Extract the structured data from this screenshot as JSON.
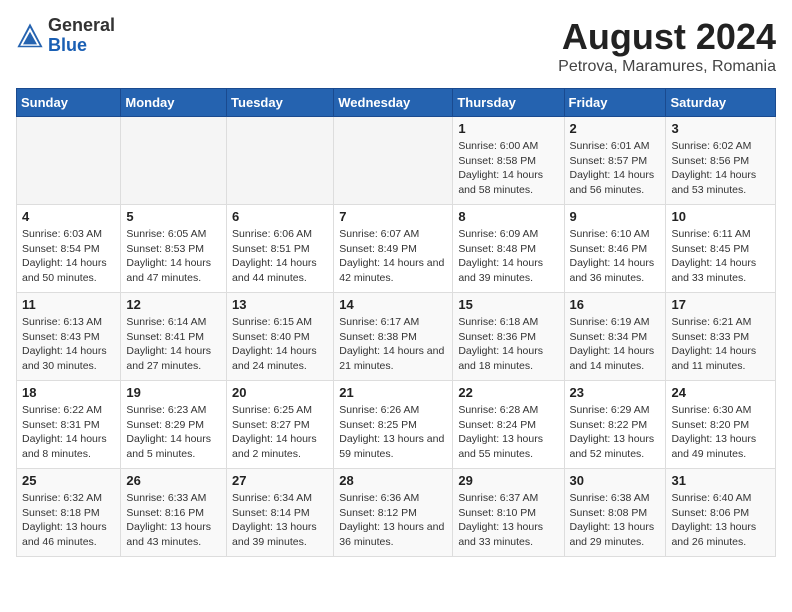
{
  "logo": {
    "general": "General",
    "blue": "Blue"
  },
  "title": "August 2024",
  "subtitle": "Petrova, Maramures, Romania",
  "days_of_week": [
    "Sunday",
    "Monday",
    "Tuesday",
    "Wednesday",
    "Thursday",
    "Friday",
    "Saturday"
  ],
  "weeks": [
    [
      {
        "day": "",
        "info": ""
      },
      {
        "day": "",
        "info": ""
      },
      {
        "day": "",
        "info": ""
      },
      {
        "day": "",
        "info": ""
      },
      {
        "day": "1",
        "info": "Sunrise: 6:00 AM\nSunset: 8:58 PM\nDaylight: 14 hours and 58 minutes."
      },
      {
        "day": "2",
        "info": "Sunrise: 6:01 AM\nSunset: 8:57 PM\nDaylight: 14 hours and 56 minutes."
      },
      {
        "day": "3",
        "info": "Sunrise: 6:02 AM\nSunset: 8:56 PM\nDaylight: 14 hours and 53 minutes."
      }
    ],
    [
      {
        "day": "4",
        "info": "Sunrise: 6:03 AM\nSunset: 8:54 PM\nDaylight: 14 hours and 50 minutes."
      },
      {
        "day": "5",
        "info": "Sunrise: 6:05 AM\nSunset: 8:53 PM\nDaylight: 14 hours and 47 minutes."
      },
      {
        "day": "6",
        "info": "Sunrise: 6:06 AM\nSunset: 8:51 PM\nDaylight: 14 hours and 44 minutes."
      },
      {
        "day": "7",
        "info": "Sunrise: 6:07 AM\nSunset: 8:49 PM\nDaylight: 14 hours and 42 minutes."
      },
      {
        "day": "8",
        "info": "Sunrise: 6:09 AM\nSunset: 8:48 PM\nDaylight: 14 hours and 39 minutes."
      },
      {
        "day": "9",
        "info": "Sunrise: 6:10 AM\nSunset: 8:46 PM\nDaylight: 14 hours and 36 minutes."
      },
      {
        "day": "10",
        "info": "Sunrise: 6:11 AM\nSunset: 8:45 PM\nDaylight: 14 hours and 33 minutes."
      }
    ],
    [
      {
        "day": "11",
        "info": "Sunrise: 6:13 AM\nSunset: 8:43 PM\nDaylight: 14 hours and 30 minutes."
      },
      {
        "day": "12",
        "info": "Sunrise: 6:14 AM\nSunset: 8:41 PM\nDaylight: 14 hours and 27 minutes."
      },
      {
        "day": "13",
        "info": "Sunrise: 6:15 AM\nSunset: 8:40 PM\nDaylight: 14 hours and 24 minutes."
      },
      {
        "day": "14",
        "info": "Sunrise: 6:17 AM\nSunset: 8:38 PM\nDaylight: 14 hours and 21 minutes."
      },
      {
        "day": "15",
        "info": "Sunrise: 6:18 AM\nSunset: 8:36 PM\nDaylight: 14 hours and 18 minutes."
      },
      {
        "day": "16",
        "info": "Sunrise: 6:19 AM\nSunset: 8:34 PM\nDaylight: 14 hours and 14 minutes."
      },
      {
        "day": "17",
        "info": "Sunrise: 6:21 AM\nSunset: 8:33 PM\nDaylight: 14 hours and 11 minutes."
      }
    ],
    [
      {
        "day": "18",
        "info": "Sunrise: 6:22 AM\nSunset: 8:31 PM\nDaylight: 14 hours and 8 minutes."
      },
      {
        "day": "19",
        "info": "Sunrise: 6:23 AM\nSunset: 8:29 PM\nDaylight: 14 hours and 5 minutes."
      },
      {
        "day": "20",
        "info": "Sunrise: 6:25 AM\nSunset: 8:27 PM\nDaylight: 14 hours and 2 minutes."
      },
      {
        "day": "21",
        "info": "Sunrise: 6:26 AM\nSunset: 8:25 PM\nDaylight: 13 hours and 59 minutes."
      },
      {
        "day": "22",
        "info": "Sunrise: 6:28 AM\nSunset: 8:24 PM\nDaylight: 13 hours and 55 minutes."
      },
      {
        "day": "23",
        "info": "Sunrise: 6:29 AM\nSunset: 8:22 PM\nDaylight: 13 hours and 52 minutes."
      },
      {
        "day": "24",
        "info": "Sunrise: 6:30 AM\nSunset: 8:20 PM\nDaylight: 13 hours and 49 minutes."
      }
    ],
    [
      {
        "day": "25",
        "info": "Sunrise: 6:32 AM\nSunset: 8:18 PM\nDaylight: 13 hours and 46 minutes."
      },
      {
        "day": "26",
        "info": "Sunrise: 6:33 AM\nSunset: 8:16 PM\nDaylight: 13 hours and 43 minutes."
      },
      {
        "day": "27",
        "info": "Sunrise: 6:34 AM\nSunset: 8:14 PM\nDaylight: 13 hours and 39 minutes."
      },
      {
        "day": "28",
        "info": "Sunrise: 6:36 AM\nSunset: 8:12 PM\nDaylight: 13 hours and 36 minutes."
      },
      {
        "day": "29",
        "info": "Sunrise: 6:37 AM\nSunset: 8:10 PM\nDaylight: 13 hours and 33 minutes."
      },
      {
        "day": "30",
        "info": "Sunrise: 6:38 AM\nSunset: 8:08 PM\nDaylight: 13 hours and 29 minutes."
      },
      {
        "day": "31",
        "info": "Sunrise: 6:40 AM\nSunset: 8:06 PM\nDaylight: 13 hours and 26 minutes."
      }
    ]
  ]
}
